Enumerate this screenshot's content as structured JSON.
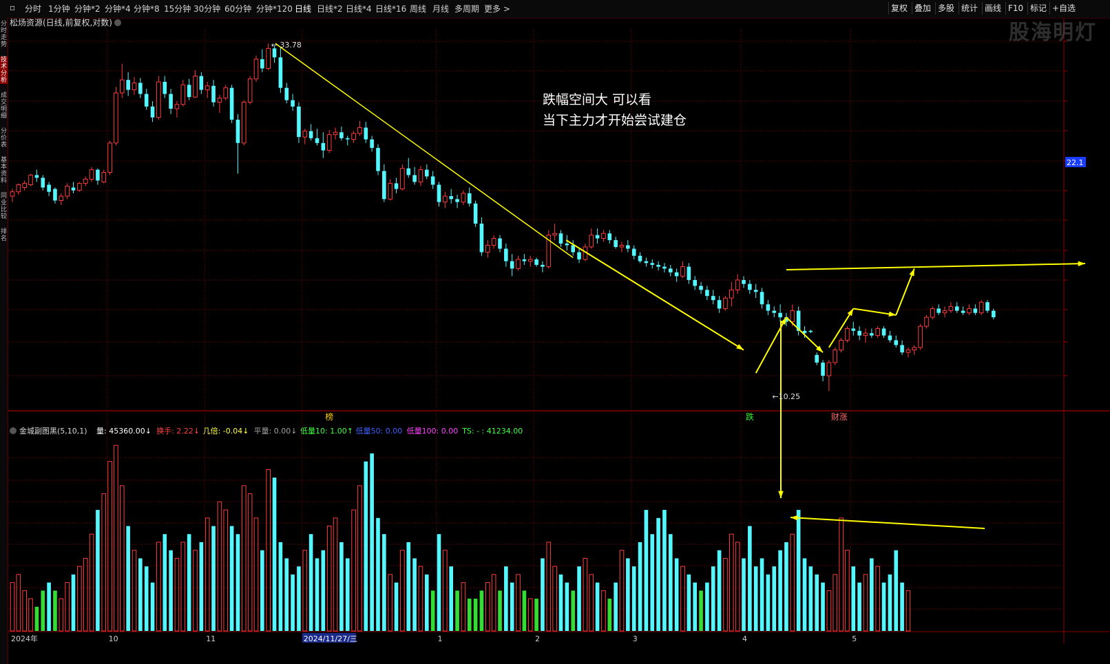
{
  "toolbar": {
    "periods": [
      "分时",
      "1分钟",
      "分钟*2",
      "分钟*4",
      "分钟*8",
      "15分钟",
      "30分钟",
      "60分钟",
      "分钟*120",
      "日线",
      "日线*2",
      "日线*4",
      "日线*16",
      "周线",
      "月线",
      "多周期",
      "更多 >"
    ],
    "active_period": "日线",
    "right_buttons": [
      "复权",
      "叠加",
      "多股",
      "统计",
      "画线",
      "F10",
      "标记",
      "+自选"
    ]
  },
  "left_tabs": [
    "分时走势",
    "技术分析",
    "成交明细",
    "分价表",
    "基本资料",
    "同业比较",
    "排名"
  ],
  "left_tab_selected": "技术分析",
  "header": {
    "title": "松炀资源(日线,前复权,对数)"
  },
  "watermark": "股海明灯",
  "annotation": {
    "line1": "跌幅空间大 可以看",
    "line2": "当下主力才开始尝试建仓"
  },
  "price_labels": {
    "high": "33.78",
    "low": "10.25",
    "current_tag": "22.1"
  },
  "markers": [
    {
      "text": "榜",
      "color": "#ffcc00",
      "index": 52
    },
    {
      "text": "跌",
      "color": "#33ee33",
      "index": 121
    },
    {
      "text": "财涨",
      "color": "#ff6666",
      "index": 135
    }
  ],
  "indicator_header": {
    "name": "金城副图黑(5,10,1)",
    "items": [
      {
        "label": "量",
        "value": "45360.00",
        "arrow": "↓",
        "color": "#ffffff"
      },
      {
        "label": "换手",
        "value": "2.22",
        "arrow": "↓",
        "color": "#ff4040"
      },
      {
        "label": "几倍",
        "value": "-0.04",
        "arrow": "↓",
        "color": "#ffff40"
      },
      {
        "label": "平量",
        "value": "0.00",
        "arrow": "↓",
        "color": "#a0a0a0"
      },
      {
        "label": "低量10",
        "value": "1.00",
        "arrow": "↑",
        "color": "#40ff40"
      },
      {
        "label": "低量50",
        "value": "0.00",
        "arrow": "",
        "color": "#4060ff"
      },
      {
        "label": "低量100",
        "value": "0.00",
        "arrow": "",
        "color": "#ff40ff"
      },
      {
        "label": "TS",
        "value": "- : 41234.00",
        "arrow": "",
        "color": "#40ff40"
      }
    ]
  },
  "x_axis": {
    "labels": [
      {
        "text": "2024年",
        "index": 0
      },
      {
        "text": "10",
        "index": 16
      },
      {
        "text": "11",
        "index": 32
      },
      {
        "text": "2024/11/27/三",
        "index": 48,
        "highlight": true
      },
      {
        "text": "1",
        "index": 70
      },
      {
        "text": "2",
        "index": 86
      },
      {
        "text": "3",
        "index": 102
      },
      {
        "text": "4",
        "index": 120
      },
      {
        "text": "5",
        "index": 138
      }
    ]
  },
  "colors": {
    "up": "#ff3c3c",
    "down": "#54f6ff",
    "grid": "#7a0000",
    "trend": "#ffff00"
  },
  "chart_data": {
    "type": "candlestick",
    "scale": "log",
    "price_ylim": [
      9.6,
      35.5
    ],
    "ohlc": [
      [
        20.0,
        20.5,
        19.6,
        20.3
      ],
      [
        20.3,
        20.9,
        20.1,
        20.8
      ],
      [
        20.6,
        21.1,
        20.4,
        20.9
      ],
      [
        20.8,
        21.6,
        20.7,
        21.5
      ],
      [
        21.5,
        21.9,
        21.0,
        21.3
      ],
      [
        21.3,
        21.5,
        20.4,
        20.6
      ],
      [
        20.8,
        21.0,
        20.0,
        20.3
      ],
      [
        20.5,
        20.6,
        19.5,
        19.7
      ],
      [
        19.7,
        20.2,
        19.4,
        20.0
      ],
      [
        20.0,
        20.9,
        19.8,
        20.7
      ],
      [
        20.6,
        21.0,
        20.2,
        20.4
      ],
      [
        20.4,
        21.0,
        20.3,
        20.9
      ],
      [
        20.9,
        21.4,
        20.7,
        21.2
      ],
      [
        21.2,
        22.1,
        21.0,
        21.9
      ],
      [
        21.9,
        22.0,
        20.8,
        21.1
      ],
      [
        21.0,
        21.9,
        20.9,
        21.7
      ],
      [
        21.7,
        24.2,
        21.5,
        24.0
      ],
      [
        24.0,
        29.1,
        23.8,
        28.5
      ],
      [
        28.5,
        31.5,
        28.0,
        29.8
      ],
      [
        29.8,
        30.6,
        28.2,
        28.8
      ],
      [
        28.8,
        30.1,
        28.3,
        29.5
      ],
      [
        29.5,
        30.0,
        28.0,
        28.4
      ],
      [
        28.4,
        28.9,
        26.9,
        27.2
      ],
      [
        27.2,
        27.7,
        25.8,
        26.2
      ],
      [
        26.2,
        30.2,
        26.0,
        29.6
      ],
      [
        29.6,
        30.2,
        28.0,
        28.4
      ],
      [
        28.4,
        28.9,
        26.5,
        27.0
      ],
      [
        27.0,
        27.7,
        26.2,
        27.4
      ],
      [
        27.4,
        29.8,
        27.2,
        29.3
      ],
      [
        29.3,
        29.9,
        27.8,
        28.1
      ],
      [
        28.1,
        30.8,
        28.0,
        30.2
      ],
      [
        30.2,
        30.6,
        28.4,
        28.8
      ],
      [
        28.8,
        29.6,
        28.0,
        29.2
      ],
      [
        29.2,
        29.8,
        27.2,
        27.6
      ],
      [
        27.6,
        28.3,
        26.6,
        28.0
      ],
      [
        28.0,
        29.3,
        27.8,
        29.0
      ],
      [
        29.0,
        29.3,
        25.7,
        26.0
      ],
      [
        26.0,
        26.5,
        21.6,
        24.0
      ],
      [
        24.0,
        27.8,
        23.8,
        27.6
      ],
      [
        27.6,
        30.2,
        27.4,
        29.9
      ],
      [
        29.9,
        32.4,
        29.6,
        32.0
      ],
      [
        32.0,
        33.1,
        30.6,
        31.0
      ],
      [
        31.0,
        33.78,
        30.8,
        33.2
      ],
      [
        33.2,
        33.5,
        31.6,
        32.2
      ],
      [
        32.2,
        33.4,
        28.5,
        29.0
      ],
      [
        29.0,
        29.5,
        27.5,
        27.8
      ],
      [
        27.8,
        28.4,
        26.8,
        27.2
      ],
      [
        27.2,
        27.6,
        24.0,
        24.5
      ],
      [
        24.5,
        25.2,
        23.9,
        25.0
      ],
      [
        25.0,
        25.6,
        24.2,
        24.4
      ],
      [
        24.4,
        25.2,
        23.8,
        24.0
      ],
      [
        24.0,
        24.9,
        22.8,
        23.4
      ],
      [
        23.4,
        25.1,
        23.2,
        24.7
      ],
      [
        24.7,
        25.3,
        24.3,
        24.9
      ],
      [
        24.9,
        25.4,
        24.2,
        24.4
      ],
      [
        24.4,
        24.6,
        23.8,
        24.3
      ],
      [
        24.3,
        25.0,
        24.0,
        24.8
      ],
      [
        24.8,
        25.9,
        24.6,
        25.3
      ],
      [
        25.3,
        25.8,
        24.0,
        24.3
      ],
      [
        24.3,
        24.6,
        23.3,
        23.6
      ],
      [
        23.6,
        23.9,
        21.5,
        21.8
      ],
      [
        21.8,
        22.3,
        19.6,
        19.8
      ],
      [
        19.8,
        21.2,
        19.7,
        20.9
      ],
      [
        20.9,
        21.3,
        20.2,
        20.5
      ],
      [
        20.5,
        22.3,
        20.4,
        22.0
      ],
      [
        22.0,
        22.8,
        21.3,
        21.5
      ],
      [
        21.5,
        22.1,
        20.8,
        21.0
      ],
      [
        21.0,
        22.2,
        20.7,
        21.9
      ],
      [
        21.9,
        22.3,
        21.2,
        21.4
      ],
      [
        21.4,
        21.8,
        20.5,
        20.8
      ],
      [
        20.8,
        21.0,
        19.3,
        19.6
      ],
      [
        19.6,
        20.3,
        19.2,
        20.0
      ],
      [
        20.0,
        20.5,
        19.5,
        19.8
      ],
      [
        19.8,
        20.1,
        19.2,
        19.6
      ],
      [
        19.6,
        20.4,
        19.4,
        20.2
      ],
      [
        20.2,
        20.6,
        19.3,
        19.5
      ],
      [
        19.5,
        19.7,
        18.0,
        18.2
      ],
      [
        18.2,
        18.6,
        16.3,
        16.5
      ],
      [
        16.5,
        17.2,
        16.2,
        16.9
      ],
      [
        16.9,
        17.5,
        16.7,
        17.3
      ],
      [
        17.3,
        17.5,
        16.5,
        16.7
      ],
      [
        16.7,
        17.0,
        15.7,
        16.0
      ],
      [
        16.0,
        16.4,
        15.2,
        15.6
      ],
      [
        15.6,
        16.3,
        15.5,
        16.1
      ],
      [
        16.1,
        16.4,
        15.8,
        16.0
      ],
      [
        16.0,
        16.3,
        15.7,
        16.1
      ],
      [
        16.1,
        16.2,
        15.7,
        15.8
      ],
      [
        15.8,
        16.0,
        15.4,
        15.7
      ],
      [
        15.7,
        17.8,
        15.6,
        17.5
      ],
      [
        17.5,
        18.2,
        17.2,
        17.6
      ],
      [
        17.6,
        17.8,
        16.8,
        17.0
      ],
      [
        17.0,
        17.5,
        16.6,
        16.9
      ],
      [
        16.9,
        17.2,
        16.3,
        16.5
      ],
      [
        16.5,
        16.7,
        15.9,
        16.1
      ],
      [
        16.1,
        17.0,
        16.0,
        16.8
      ],
      [
        16.8,
        17.9,
        16.7,
        17.5
      ],
      [
        17.5,
        17.9,
        17.0,
        17.3
      ],
      [
        17.3,
        17.8,
        17.1,
        17.6
      ],
      [
        17.6,
        17.8,
        17.0,
        17.2
      ],
      [
        17.2,
        17.4,
        16.7,
        16.8
      ],
      [
        16.8,
        17.1,
        16.5,
        16.9
      ],
      [
        16.9,
        17.2,
        16.5,
        16.7
      ],
      [
        16.7,
        16.9,
        16.1,
        16.3
      ],
      [
        16.3,
        16.5,
        15.9,
        16.0
      ],
      [
        16.0,
        16.2,
        15.7,
        15.9
      ],
      [
        15.9,
        16.1,
        15.6,
        15.8
      ],
      [
        15.8,
        16.0,
        15.5,
        15.7
      ],
      [
        15.7,
        15.9,
        15.4,
        15.6
      ],
      [
        15.6,
        15.8,
        15.2,
        15.4
      ],
      [
        15.4,
        15.6,
        14.9,
        15.2
      ],
      [
        15.2,
        16.0,
        15.1,
        15.7
      ],
      [
        15.7,
        15.9,
        14.8,
        15.0
      ],
      [
        15.0,
        15.2,
        14.5,
        14.7
      ],
      [
        14.7,
        14.9,
        14.3,
        14.5
      ],
      [
        14.5,
        14.7,
        14.0,
        14.2
      ],
      [
        14.2,
        14.5,
        13.8,
        14.0
      ],
      [
        14.0,
        14.2,
        13.4,
        13.6
      ],
      [
        13.6,
        14.2,
        13.5,
        14.1
      ],
      [
        14.1,
        14.9,
        13.7,
        14.5
      ],
      [
        14.5,
        15.3,
        14.3,
        15.0
      ],
      [
        15.0,
        15.2,
        14.6,
        14.8
      ],
      [
        14.8,
        15.0,
        14.3,
        14.5
      ],
      [
        14.5,
        14.8,
        14.1,
        14.4
      ],
      [
        14.4,
        14.6,
        13.6,
        13.8
      ],
      [
        13.8,
        14.0,
        13.3,
        13.5
      ],
      [
        13.5,
        13.7,
        13.2,
        13.4
      ],
      [
        13.4,
        13.8,
        13.0,
        13.2
      ],
      [
        13.2,
        13.4,
        12.8,
        13.0
      ],
      [
        13.0,
        13.8,
        12.8,
        13.5
      ],
      [
        13.5,
        13.7,
        12.4,
        12.6
      ],
      [
        12.6,
        12.8,
        12.3,
        12.5
      ],
      [
        12.6,
        12.65,
        12.5,
        12.55
      ],
      [
        11.6,
        11.7,
        11.2,
        11.3
      ],
      [
        11.3,
        11.4,
        10.6,
        10.8
      ],
      [
        10.8,
        11.4,
        10.25,
        11.3
      ],
      [
        11.3,
        11.9,
        11.2,
        11.8
      ],
      [
        11.8,
        12.3,
        11.7,
        12.2
      ],
      [
        12.2,
        12.8,
        12.1,
        12.7
      ],
      [
        12.7,
        13.0,
        12.4,
        12.6
      ],
      [
        12.6,
        12.8,
        12.2,
        12.4
      ],
      [
        12.4,
        12.7,
        12.1,
        12.5
      ],
      [
        12.5,
        12.7,
        12.3,
        12.4
      ],
      [
        12.4,
        12.8,
        12.3,
        12.7
      ],
      [
        12.7,
        12.8,
        12.3,
        12.4
      ],
      [
        12.4,
        12.6,
        12.1,
        12.2
      ],
      [
        12.2,
        12.4,
        11.9,
        12.0
      ],
      [
        12.0,
        12.2,
        11.6,
        11.7
      ],
      [
        11.7,
        11.9,
        11.5,
        11.8
      ],
      [
        11.8,
        12.0,
        11.6,
        11.9
      ],
      [
        11.9,
        12.9,
        11.8,
        12.8
      ],
      [
        12.8,
        13.3,
        12.7,
        13.2
      ],
      [
        13.2,
        13.7,
        13.1,
        13.6
      ],
      [
        13.6,
        13.8,
        13.3,
        13.4
      ],
      [
        13.4,
        13.7,
        13.2,
        13.5
      ],
      [
        13.5,
        13.9,
        13.4,
        13.7
      ],
      [
        13.7,
        13.9,
        13.4,
        13.5
      ],
      [
        13.5,
        13.7,
        13.3,
        13.4
      ],
      [
        13.4,
        13.8,
        13.3,
        13.6
      ],
      [
        13.6,
        13.8,
        13.3,
        13.4
      ],
      [
        13.4,
        14.0,
        13.3,
        13.9
      ],
      [
        13.9,
        14.0,
        13.4,
        13.5
      ],
      [
        13.5,
        13.6,
        13.1,
        13.2
      ]
    ],
    "volume": [
      6,
      7,
      5,
      4,
      3,
      5,
      6,
      5,
      4,
      6,
      7,
      8,
      9,
      12,
      15,
      17,
      21,
      23,
      18,
      13,
      10,
      9,
      8,
      6,
      11,
      12,
      10,
      9,
      11,
      12,
      10,
      11,
      14,
      13,
      16,
      15,
      13,
      12,
      18,
      17,
      14,
      10,
      20,
      19,
      11,
      9,
      7,
      8,
      10,
      12,
      9,
      10,
      13,
      14,
      11,
      9,
      15,
      18,
      21,
      22,
      14,
      12,
      7,
      6,
      10,
      11,
      9,
      8,
      7,
      5,
      12,
      10,
      8,
      5,
      6,
      4,
      4,
      5,
      6,
      7,
      5,
      8,
      6,
      7,
      5,
      4,
      4,
      9,
      11,
      8,
      7,
      6,
      5,
      8,
      9,
      7,
      6,
      5,
      4,
      6,
      10,
      9,
      8,
      11,
      15,
      12,
      14,
      15,
      12,
      9,
      8,
      7,
      6,
      5,
      6,
      8,
      10,
      9,
      12,
      11,
      9,
      13,
      8,
      9,
      7,
      8,
      10,
      11,
      12,
      15,
      9,
      8,
      7,
      6,
      5,
      7,
      14,
      10,
      8,
      6,
      7,
      9,
      8,
      6,
      7,
      10,
      6,
      5
    ]
  }
}
